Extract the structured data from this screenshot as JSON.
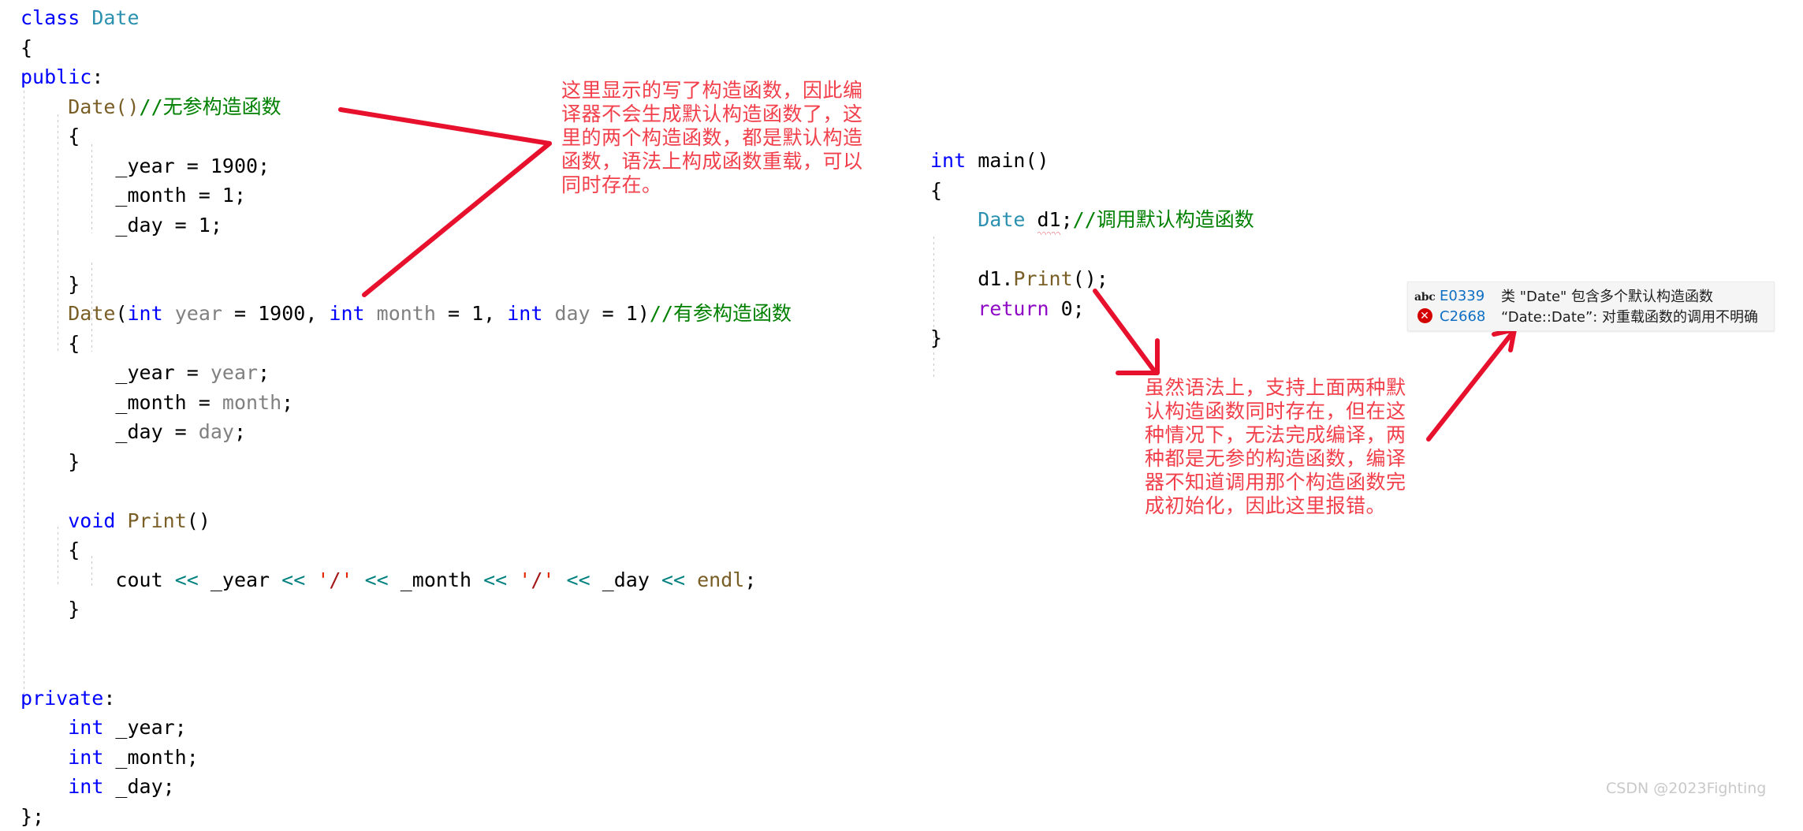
{
  "editor": {
    "left_code": [
      {
        "indent": 0,
        "tokens": [
          {
            "t": "class ",
            "c": "kw"
          },
          {
            "t": "Date",
            "c": "type"
          }
        ]
      },
      {
        "indent": 0,
        "tokens": [
          {
            "t": "{",
            "c": "punc"
          }
        ]
      },
      {
        "indent": 0,
        "tokens": [
          {
            "t": "public",
            "c": "kw"
          },
          {
            "t": ":",
            "c": "punc"
          }
        ]
      },
      {
        "indent": 1,
        "tokens": [
          {
            "t": "Date()",
            "c": "fn"
          },
          {
            "t": "//无参构造函数",
            "c": "cmt"
          }
        ]
      },
      {
        "indent": 1,
        "tokens": [
          {
            "t": "{",
            "c": "punc"
          }
        ]
      },
      {
        "indent": 2,
        "tokens": [
          {
            "t": "_year = ",
            "c": "plain"
          },
          {
            "t": "1900",
            "c": "num"
          },
          {
            "t": ";",
            "c": "punc"
          }
        ]
      },
      {
        "indent": 2,
        "tokens": [
          {
            "t": "_month = ",
            "c": "plain"
          },
          {
            "t": "1",
            "c": "num"
          },
          {
            "t": ";",
            "c": "punc"
          }
        ]
      },
      {
        "indent": 2,
        "tokens": [
          {
            "t": "_day = ",
            "c": "plain"
          },
          {
            "t": "1",
            "c": "num"
          },
          {
            "t": ";",
            "c": "punc"
          }
        ]
      },
      {
        "indent": 0,
        "tokens": [
          {
            "t": " ",
            "c": "plain"
          }
        ]
      },
      {
        "indent": 1,
        "tokens": [
          {
            "t": "}",
            "c": "punc"
          }
        ]
      },
      {
        "indent": 1,
        "tokens": [
          {
            "t": "Date",
            "c": "fn"
          },
          {
            "t": "(",
            "c": "punc"
          },
          {
            "t": "int",
            "c": "kw"
          },
          {
            "t": " ",
            "c": "plain"
          },
          {
            "t": "year",
            "c": "var"
          },
          {
            "t": " = ",
            "c": "plain"
          },
          {
            "t": "1900",
            "c": "num"
          },
          {
            "t": ", ",
            "c": "punc"
          },
          {
            "t": "int",
            "c": "kw"
          },
          {
            "t": " ",
            "c": "plain"
          },
          {
            "t": "month",
            "c": "var"
          },
          {
            "t": " = ",
            "c": "plain"
          },
          {
            "t": "1",
            "c": "num"
          },
          {
            "t": ", ",
            "c": "punc"
          },
          {
            "t": "int",
            "c": "kw"
          },
          {
            "t": " ",
            "c": "plain"
          },
          {
            "t": "day",
            "c": "var"
          },
          {
            "t": " = ",
            "c": "plain"
          },
          {
            "t": "1",
            "c": "num"
          },
          {
            "t": ")",
            "c": "punc"
          },
          {
            "t": "//有参构造函数",
            "c": "cmt"
          }
        ]
      },
      {
        "indent": 1,
        "tokens": [
          {
            "t": "{",
            "c": "punc"
          }
        ]
      },
      {
        "indent": 2,
        "tokens": [
          {
            "t": "_year = ",
            "c": "plain"
          },
          {
            "t": "year",
            "c": "var"
          },
          {
            "t": ";",
            "c": "punc"
          }
        ]
      },
      {
        "indent": 2,
        "tokens": [
          {
            "t": "_month = ",
            "c": "plain"
          },
          {
            "t": "month",
            "c": "var"
          },
          {
            "t": ";",
            "c": "punc"
          }
        ]
      },
      {
        "indent": 2,
        "tokens": [
          {
            "t": "_day = ",
            "c": "plain"
          },
          {
            "t": "day",
            "c": "var"
          },
          {
            "t": ";",
            "c": "punc"
          }
        ]
      },
      {
        "indent": 1,
        "tokens": [
          {
            "t": "}",
            "c": "punc"
          }
        ]
      },
      {
        "indent": 0,
        "tokens": [
          {
            "t": " ",
            "c": "plain"
          }
        ]
      },
      {
        "indent": 1,
        "tokens": [
          {
            "t": "void",
            "c": "kw"
          },
          {
            "t": " ",
            "c": "plain"
          },
          {
            "t": "Print",
            "c": "fn"
          },
          {
            "t": "()",
            "c": "punc"
          }
        ]
      },
      {
        "indent": 1,
        "tokens": [
          {
            "t": "{",
            "c": "punc"
          }
        ]
      },
      {
        "indent": 2,
        "tokens": [
          {
            "t": "cout ",
            "c": "plain"
          },
          {
            "t": "<<",
            "c": "op"
          },
          {
            "t": " _year ",
            "c": "plain"
          },
          {
            "t": "<<",
            "c": "op"
          },
          {
            "t": " ",
            "c": "plain"
          },
          {
            "t": "'",
            "c": "strq"
          },
          {
            "t": "/",
            "c": "str"
          },
          {
            "t": "'",
            "c": "strq"
          },
          {
            "t": " ",
            "c": "plain"
          },
          {
            "t": "<<",
            "c": "op"
          },
          {
            "t": " _month ",
            "c": "plain"
          },
          {
            "t": "<<",
            "c": "op"
          },
          {
            "t": " ",
            "c": "plain"
          },
          {
            "t": "'",
            "c": "strq"
          },
          {
            "t": "/",
            "c": "str"
          },
          {
            "t": "'",
            "c": "strq"
          },
          {
            "t": " ",
            "c": "plain"
          },
          {
            "t": "<<",
            "c": "op"
          },
          {
            "t": " _day ",
            "c": "plain"
          },
          {
            "t": "<<",
            "c": "op"
          },
          {
            "t": " ",
            "c": "plain"
          },
          {
            "t": "endl",
            "c": "fn"
          },
          {
            "t": ";",
            "c": "punc"
          }
        ]
      },
      {
        "indent": 1,
        "tokens": [
          {
            "t": "}",
            "c": "punc"
          }
        ]
      },
      {
        "indent": 0,
        "tokens": [
          {
            "t": " ",
            "c": "plain"
          }
        ]
      },
      {
        "indent": 0,
        "tokens": [
          {
            "t": " ",
            "c": "plain"
          }
        ]
      },
      {
        "indent": 0,
        "tokens": [
          {
            "t": "private",
            "c": "kw"
          },
          {
            "t": ":",
            "c": "punc"
          }
        ]
      },
      {
        "indent": 1,
        "tokens": [
          {
            "t": "int",
            "c": "kw"
          },
          {
            "t": " _year;",
            "c": "plain"
          }
        ]
      },
      {
        "indent": 1,
        "tokens": [
          {
            "t": "int",
            "c": "kw"
          },
          {
            "t": " _month;",
            "c": "plain"
          }
        ]
      },
      {
        "indent": 1,
        "tokens": [
          {
            "t": "int",
            "c": "kw"
          },
          {
            "t": " _day;",
            "c": "plain"
          }
        ]
      },
      {
        "indent": 0,
        "tokens": [
          {
            "t": "};",
            "c": "punc"
          }
        ]
      }
    ],
    "right_code": [
      {
        "indent": 0,
        "tokens": [
          {
            "t": "int",
            "c": "kw"
          },
          {
            "t": " ",
            "c": "plain"
          },
          {
            "t": "main",
            "c": "plain"
          },
          {
            "t": "()",
            "c": "punc"
          }
        ]
      },
      {
        "indent": 0,
        "tokens": [
          {
            "t": "{",
            "c": "punc"
          }
        ]
      },
      {
        "indent": 1,
        "tokens": [
          {
            "t": "Date",
            "c": "type"
          },
          {
            "t": " ",
            "c": "plain"
          },
          {
            "t": "d1",
            "c": "plain",
            "squiggle": true
          },
          {
            "t": ";",
            "c": "punc"
          },
          {
            "t": "//调用默认构造函数",
            "c": "cmt"
          }
        ]
      },
      {
        "indent": 0,
        "tokens": [
          {
            "t": " ",
            "c": "plain"
          }
        ]
      },
      {
        "indent": 1,
        "tokens": [
          {
            "t": "d1",
            "c": "plain"
          },
          {
            "t": ".",
            "c": "punc"
          },
          {
            "t": "Print",
            "c": "fn"
          },
          {
            "t": "()",
            "c": "punc"
          },
          {
            "t": ";",
            "c": "punc"
          }
        ]
      },
      {
        "indent": 1,
        "tokens": [
          {
            "t": "return",
            "c": "ret"
          },
          {
            "t": " ",
            "c": "plain"
          },
          {
            "t": "0",
            "c": "num"
          },
          {
            "t": ";",
            "c": "punc"
          }
        ]
      },
      {
        "indent": 0,
        "tokens": [
          {
            "t": "}",
            "c": "punc"
          }
        ]
      }
    ]
  },
  "annotations": {
    "left_note": "这里显示的写了构造函数，因此编\n译器不会生成默认构造函数了，这\n里的两个构造函数，都是默认构造\n函数，语法上构成函数重载，可以\n同时存在。",
    "right_note": "虽然语法上，支持上面两种默\n认构造函数同时存在，但在这\n种情况下，无法完成编译，两\n种都是无参的构造函数，编译\n器不知道调用那个构造函数完\n成初始化，因此这里报错。",
    "accent_color": "#f1404b"
  },
  "error_panel": {
    "rows": [
      {
        "icon": "spellcheck-abc-icon",
        "code": "E0339",
        "message": "类 \"Date\" 包含多个默认构造函数"
      },
      {
        "icon": "error-x-icon",
        "code": "C2668",
        "message": "“Date::Date”: 对重载函数的调用不明确"
      }
    ]
  },
  "watermark": {
    "text": "CSDN @2023Fighting"
  }
}
